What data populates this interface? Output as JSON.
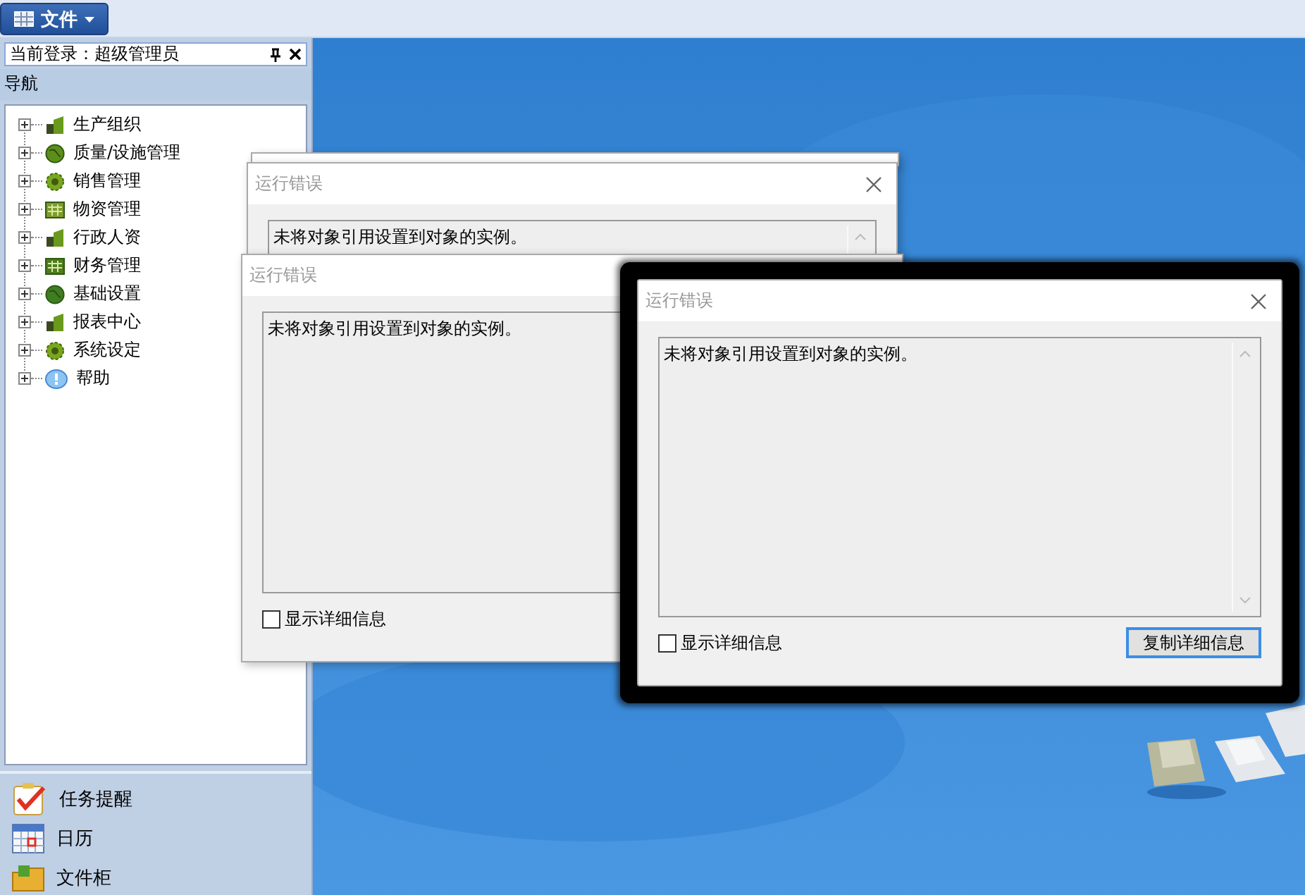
{
  "menu": {
    "label": "文件"
  },
  "login_panel": {
    "title": "当前登录：超级管理员"
  },
  "navigation": {
    "title": "导航",
    "items": [
      {
        "label": "生产组织",
        "expanded": false
      },
      {
        "label": "质量/设施管理",
        "expanded": false
      },
      {
        "label": "销售管理",
        "expanded": false
      },
      {
        "label": "物资管理",
        "expanded": false
      },
      {
        "label": "行政人资",
        "expanded": false
      },
      {
        "label": "财务管理",
        "expanded": false
      },
      {
        "label": "基础设置",
        "expanded": false
      },
      {
        "label": "报表中心",
        "expanded": false
      },
      {
        "label": "系统设定",
        "expanded": false
      },
      {
        "label": "帮助",
        "expanded": false
      }
    ]
  },
  "shortcuts": [
    {
      "label": "任务提醒"
    },
    {
      "label": "日历"
    },
    {
      "label": "文件柜"
    }
  ],
  "dialogs": [
    {
      "title": "运行错误",
      "message": "未将对象引用设置到对象的实例。",
      "focused": false
    },
    {
      "title": "运行错误",
      "message": "未将对象引用设置到对象的实例。",
      "focused": false,
      "checkbox": {
        "label": "显示详细信息",
        "checked": false
      }
    },
    {
      "title": "运行错误",
      "message": "未将对象引用设置到对象的实例。",
      "focused": true,
      "checkbox": {
        "label": "显示详细信息",
        "checked": false
      },
      "button": "复制详细信息"
    }
  ]
}
